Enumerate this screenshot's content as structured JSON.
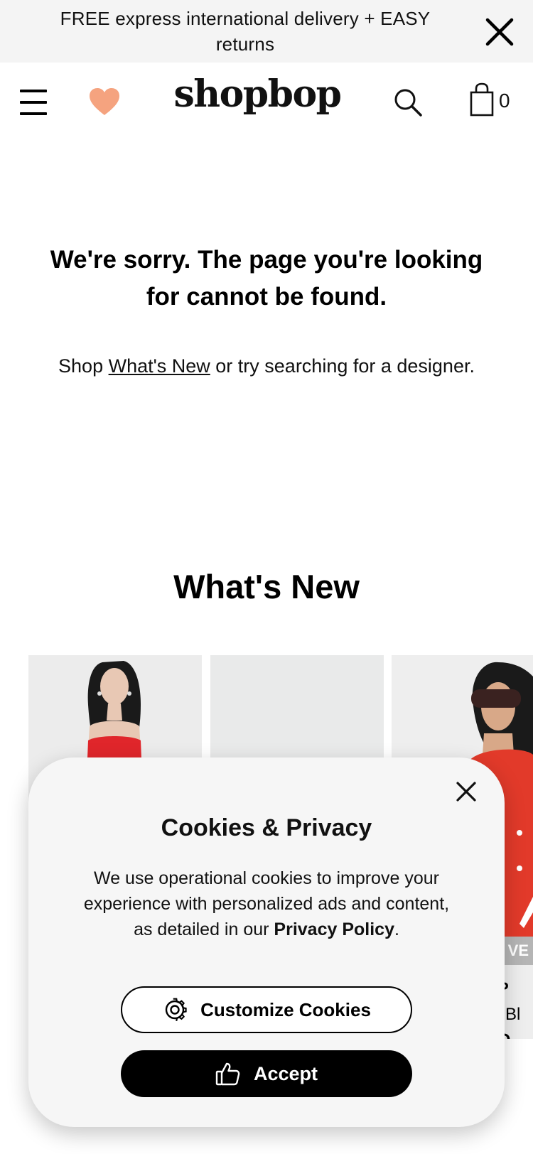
{
  "promo": {
    "text_line1": "FREE express international delivery + EASY",
    "text_line2": "returns"
  },
  "header": {
    "logo": "shopbop",
    "bag_count": "0",
    "icons": [
      "menu-icon",
      "heart-icon",
      "search-icon",
      "bag-icon"
    ],
    "heart_color": "#f5a37f"
  },
  "error": {
    "title_line1": "We're sorry. The page you're looking",
    "title_line2": "for cannot be found.",
    "sub_prefix": "Shop ",
    "sub_link": "What's New",
    "sub_suffix": " or try searching for a designer."
  },
  "whats_new": {
    "title": "What's New",
    "products": [
      {
        "dress_color": "#e0262b"
      },
      {
        "dress_color": ""
      },
      {
        "sale_tag": "VE",
        "brand": "P",
        "name": "n Bl",
        "price": "D",
        "dress_color": "#e23a2a"
      }
    ]
  },
  "cookies": {
    "title": "Cookies & Privacy",
    "text_line1": "We use operational cookies to improve your",
    "text_line2": "experience with personalized ads and content,",
    "text_line3_prefix": "as detailed in our ",
    "privacy_link": "Privacy Policy",
    "text_line3_suffix": ".",
    "customize_label": "Customize Cookies",
    "accept_label": "Accept",
    "icons": [
      "close-icon",
      "gear-icon",
      "thumbs-up-icon"
    ]
  }
}
